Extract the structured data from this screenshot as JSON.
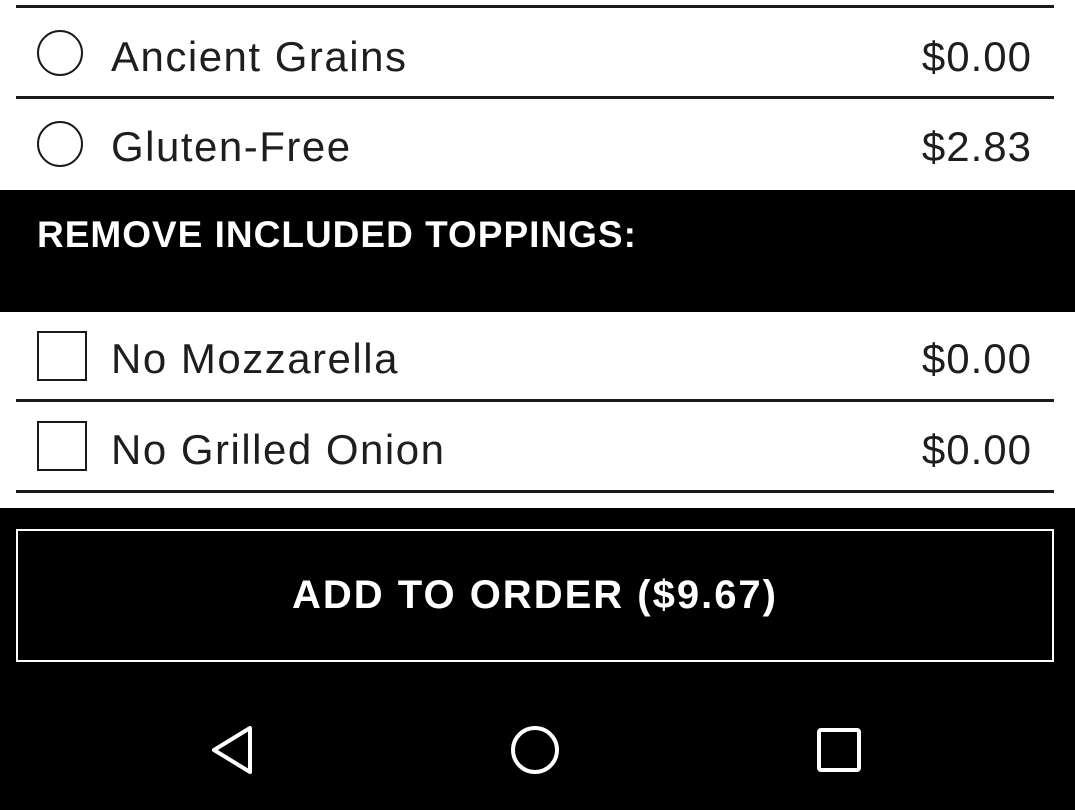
{
  "crust_options": [
    {
      "label": "Ancient Grains",
      "price": "$0.00"
    },
    {
      "label": "Gluten-Free",
      "price": "$2.83"
    }
  ],
  "remove_toppings": {
    "title": "REMOVE INCLUDED TOPPINGS:",
    "items": [
      {
        "label": "No Mozzarella",
        "price": "$0.00"
      },
      {
        "label": "No Grilled Onion",
        "price": "$0.00"
      }
    ]
  },
  "add_to_order": {
    "label": "ADD TO ORDER ($9.67)"
  },
  "nav": {
    "back_icon": "back-triangle-icon",
    "home_icon": "home-circle-icon",
    "recents_icon": "recents-square-icon"
  },
  "colors": {
    "background": "#ffffff",
    "accent": "#000000",
    "text": "#1e1e1e"
  }
}
